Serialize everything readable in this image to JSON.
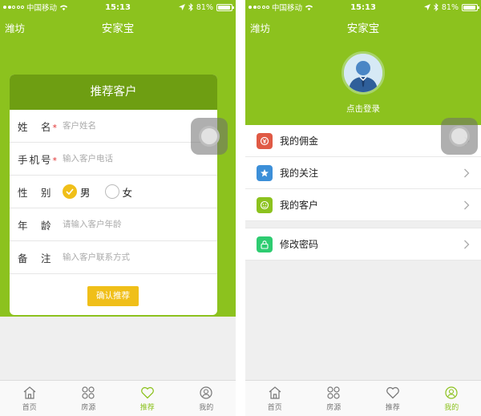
{
  "status_bar": {
    "carrier": "中国移动",
    "time": "15:13",
    "battery": "81%",
    "battery_level": 0.81
  },
  "left_screen": {
    "nav": {
      "city": "潍坊",
      "title": "安家宝"
    },
    "card": {
      "title": "推荐客户",
      "fields": {
        "name": {
          "label": "姓　名",
          "required_mark": "*",
          "placeholder": "客户姓名"
        },
        "phone": {
          "label": "手机号",
          "required_mark": "*",
          "placeholder": "输入客户电话"
        },
        "gender": {
          "label": "性　别",
          "options": [
            "男",
            "女"
          ],
          "selected": "男"
        },
        "age": {
          "label": "年　龄",
          "placeholder": "请输入客户年龄"
        },
        "note": {
          "label": "备　注",
          "placeholder": "输入客户联系方式"
        }
      },
      "submit_label": "确认推荐"
    },
    "active_tab": "推荐"
  },
  "right_screen": {
    "nav": {
      "city": "潍坊",
      "title": "安家宝"
    },
    "login_text": "点击登录",
    "menu": [
      {
        "label": "我的佣金",
        "icon": "commission-icon",
        "color": "#e05a45"
      },
      {
        "label": "我的关注",
        "icon": "star-icon",
        "color": "#3c8fd8"
      },
      {
        "label": "我的客户",
        "icon": "customers-icon",
        "color": "#8cc21e"
      }
    ],
    "menu_secondary": [
      {
        "label": "修改密码",
        "icon": "lock-icon",
        "color": "#2ecc71"
      }
    ],
    "active_tab": "我的"
  },
  "tabs": [
    {
      "label": "首页",
      "icon": "home-icon"
    },
    {
      "label": "房源",
      "icon": "listings-icon"
    },
    {
      "label": "推荐",
      "icon": "heart-icon"
    },
    {
      "label": "我的",
      "icon": "profile-icon"
    }
  ],
  "colors": {
    "accent": "#8cc21e",
    "card_header": "#6e9e12",
    "button": "#f0bf19"
  }
}
